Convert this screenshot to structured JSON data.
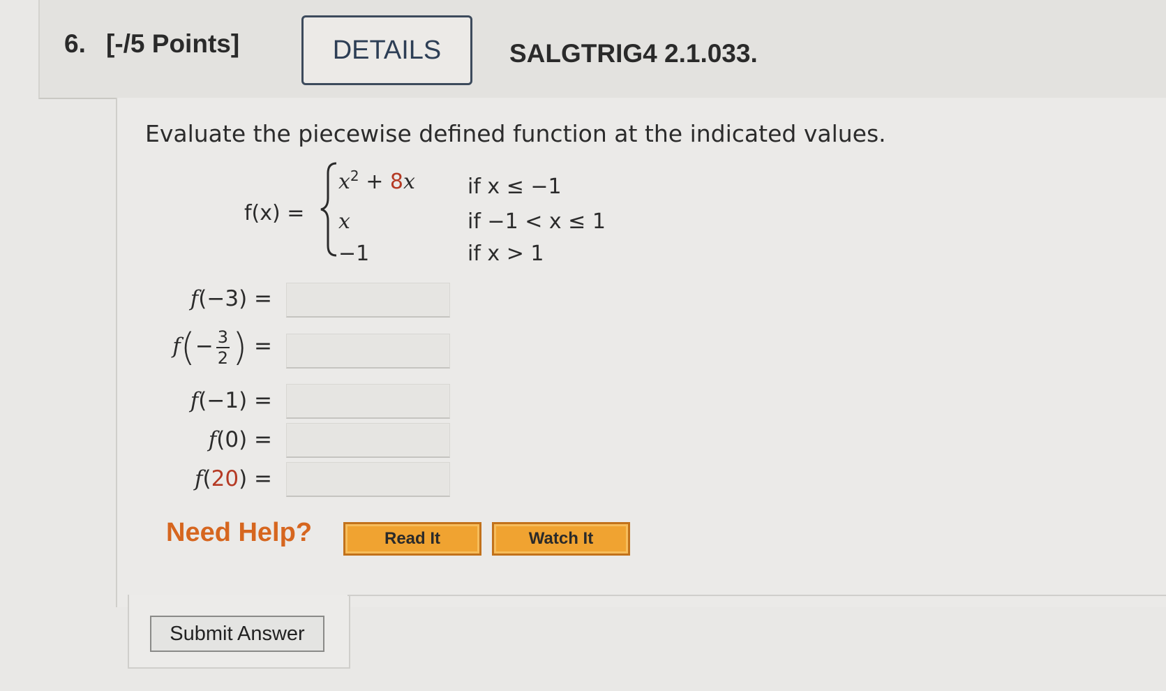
{
  "question": {
    "number": "6.",
    "points": "[-/5 Points]",
    "details_label": "DETAILS",
    "code": "SALGTRIG4 2.1.033."
  },
  "problem": {
    "instruction": "Evaluate the piecewise defined function at the indicated values.",
    "function_label": "f(x) =",
    "cases": [
      {
        "expr_base": "x",
        "expr_sup": "2",
        "expr_rest": " + ",
        "expr_coef": "8",
        "expr_var": "x",
        "condition": "if x ≤ −1"
      },
      {
        "expr": "x",
        "condition": "if −1 < x ≤ 1"
      },
      {
        "expr": "−1",
        "condition": "if x > 1"
      }
    ]
  },
  "evaluations": [
    {
      "func": "f",
      "arg": "−3",
      "equals": "=",
      "answer": ""
    },
    {
      "func": "f",
      "sign": "−",
      "num": "3",
      "den": "2",
      "equals": "=",
      "answer": ""
    },
    {
      "func": "f",
      "arg": "−1",
      "equals": "=",
      "answer": ""
    },
    {
      "func": "f",
      "arg": "0",
      "equals": "=",
      "answer": ""
    },
    {
      "func": "f",
      "arg": "20",
      "equals": "=",
      "answer": ""
    }
  ],
  "help": {
    "label": "Need Help?",
    "read_it": "Read It",
    "watch_it": "Watch It"
  },
  "submit": {
    "label": "Submit Answer"
  },
  "colors": {
    "accent_orange": "#d6661f",
    "button_orange": "#f0a331",
    "red_number": "#b53a24",
    "details_border": "#3c4a5c"
  }
}
